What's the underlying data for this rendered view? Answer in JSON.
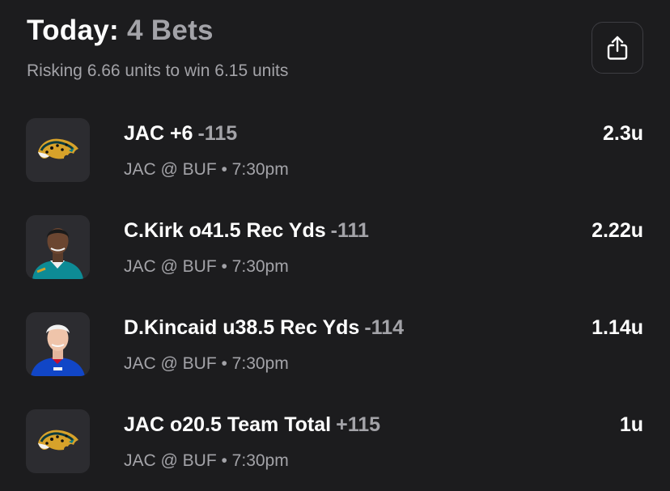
{
  "header": {
    "title_prefix": "Today:",
    "title_count": "4 Bets",
    "subtitle": "Risking 6.66 units to win 6.15 units"
  },
  "share": {
    "icon": "share-icon"
  },
  "bets": [
    {
      "pick": "JAC +6",
      "odds": "-115",
      "matchup": "JAC @ BUF • 7:30pm",
      "units": "2.3u",
      "image": "jaguars-logo"
    },
    {
      "pick": "C.Kirk o41.5 Rec Yds",
      "odds": "-111",
      "matchup": "JAC @ BUF • 7:30pm",
      "units": "2.22u",
      "image": "player-headshot-teal-jersey"
    },
    {
      "pick": "D.Kincaid u38.5 Rec Yds",
      "odds": "-114",
      "matchup": "JAC @ BUF • 7:30pm",
      "units": "1.14u",
      "image": "player-headshot-blue-jersey"
    },
    {
      "pick": "JAC o20.5 Team Total",
      "odds": "+115",
      "matchup": "JAC @ BUF • 7:30pm",
      "units": "1u",
      "image": "jaguars-logo"
    }
  ],
  "colors": {
    "background": "#1c1c1e",
    "muted": "#a3a3a8",
    "thumb": "#2c2c30",
    "teal": "#0d8b95",
    "bills_blue": "#1146c7"
  }
}
